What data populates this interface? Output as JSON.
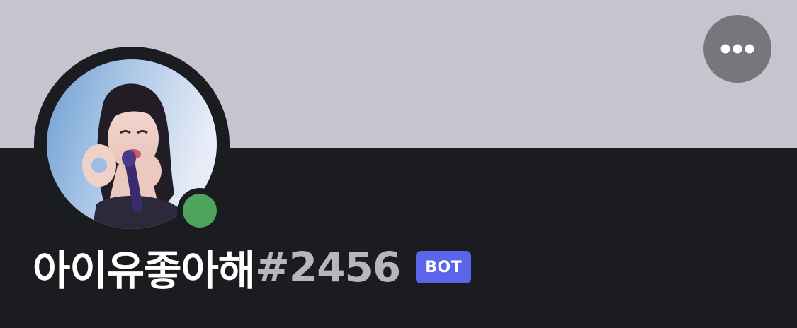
{
  "profile": {
    "username": "아이유좋아해",
    "discriminator": "#2456",
    "bot_badge": "BOT",
    "status": "online",
    "avatar_icon": "user-avatar-photo"
  },
  "header": {
    "more_icon": "more-horizontal-icon"
  },
  "colors": {
    "banner": "#c6c4ce",
    "background": "#1b1c20",
    "status_online": "#4fa45c",
    "bot_badge": "#5a65ea",
    "more_button": "#77767b"
  }
}
